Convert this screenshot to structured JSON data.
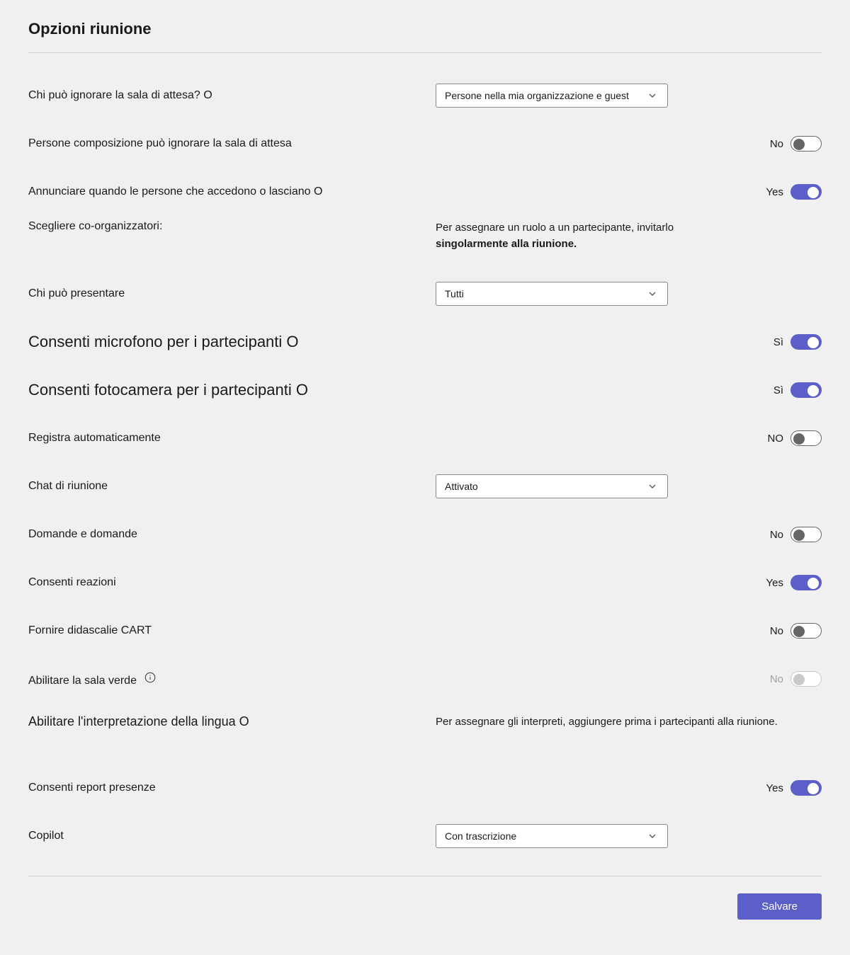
{
  "title": "Opzioni riunione",
  "rows": {
    "bypass_lobby": {
      "label": "Chi può ignorare la sala di attesa? O",
      "value": "Persone nella mia organizzazione e guest"
    },
    "callers_bypass": {
      "label": "Persone composizione può ignorare la sala di attesa",
      "state": "No"
    },
    "announce": {
      "label": "Annunciare quando le persone che accedono o lasciano O",
      "state": "Yes"
    },
    "coorganizers": {
      "label": "Scegliere co-organizzatori:"
    },
    "coorganizers_help": {
      "text1": "Per assegnare un ruolo a un partecipante, invitarlo ",
      "text2": "singolarmente alla riunione."
    },
    "presenters": {
      "label": "Chi può presentare",
      "value": "Tutti"
    },
    "allow_mic": {
      "label": "Consenti microfono per i partecipanti O",
      "state": "Sì"
    },
    "allow_cam": {
      "label": "Consenti fotocamera per i partecipanti O",
      "state": "Sì"
    },
    "auto_record": {
      "label": "Registra automaticamente",
      "state": "NO"
    },
    "meeting_chat": {
      "label": "Chat di riunione",
      "value": "Attivato"
    },
    "qna": {
      "label": "Domande e domande",
      "state": "No"
    },
    "reactions": {
      "label": "Consenti reazioni",
      "state": "Yes"
    },
    "cart": {
      "label": "Fornire didascalie CART",
      "state": "No"
    },
    "green_room": {
      "label": "Abilitare la sala verde",
      "state": "No"
    },
    "lang_interp": {
      "label": "Abilitare l'interpretazione della lingua O"
    },
    "lang_interp_help": {
      "text": "Per assegnare gli interpreti, aggiungere prima i partecipanti alla riunione."
    },
    "attendance": {
      "label": "Consenti report presenze",
      "state": "Yes"
    },
    "copilot": {
      "label": "Copilot",
      "value": "Con trascrizione"
    }
  },
  "save_label": "Salvare"
}
